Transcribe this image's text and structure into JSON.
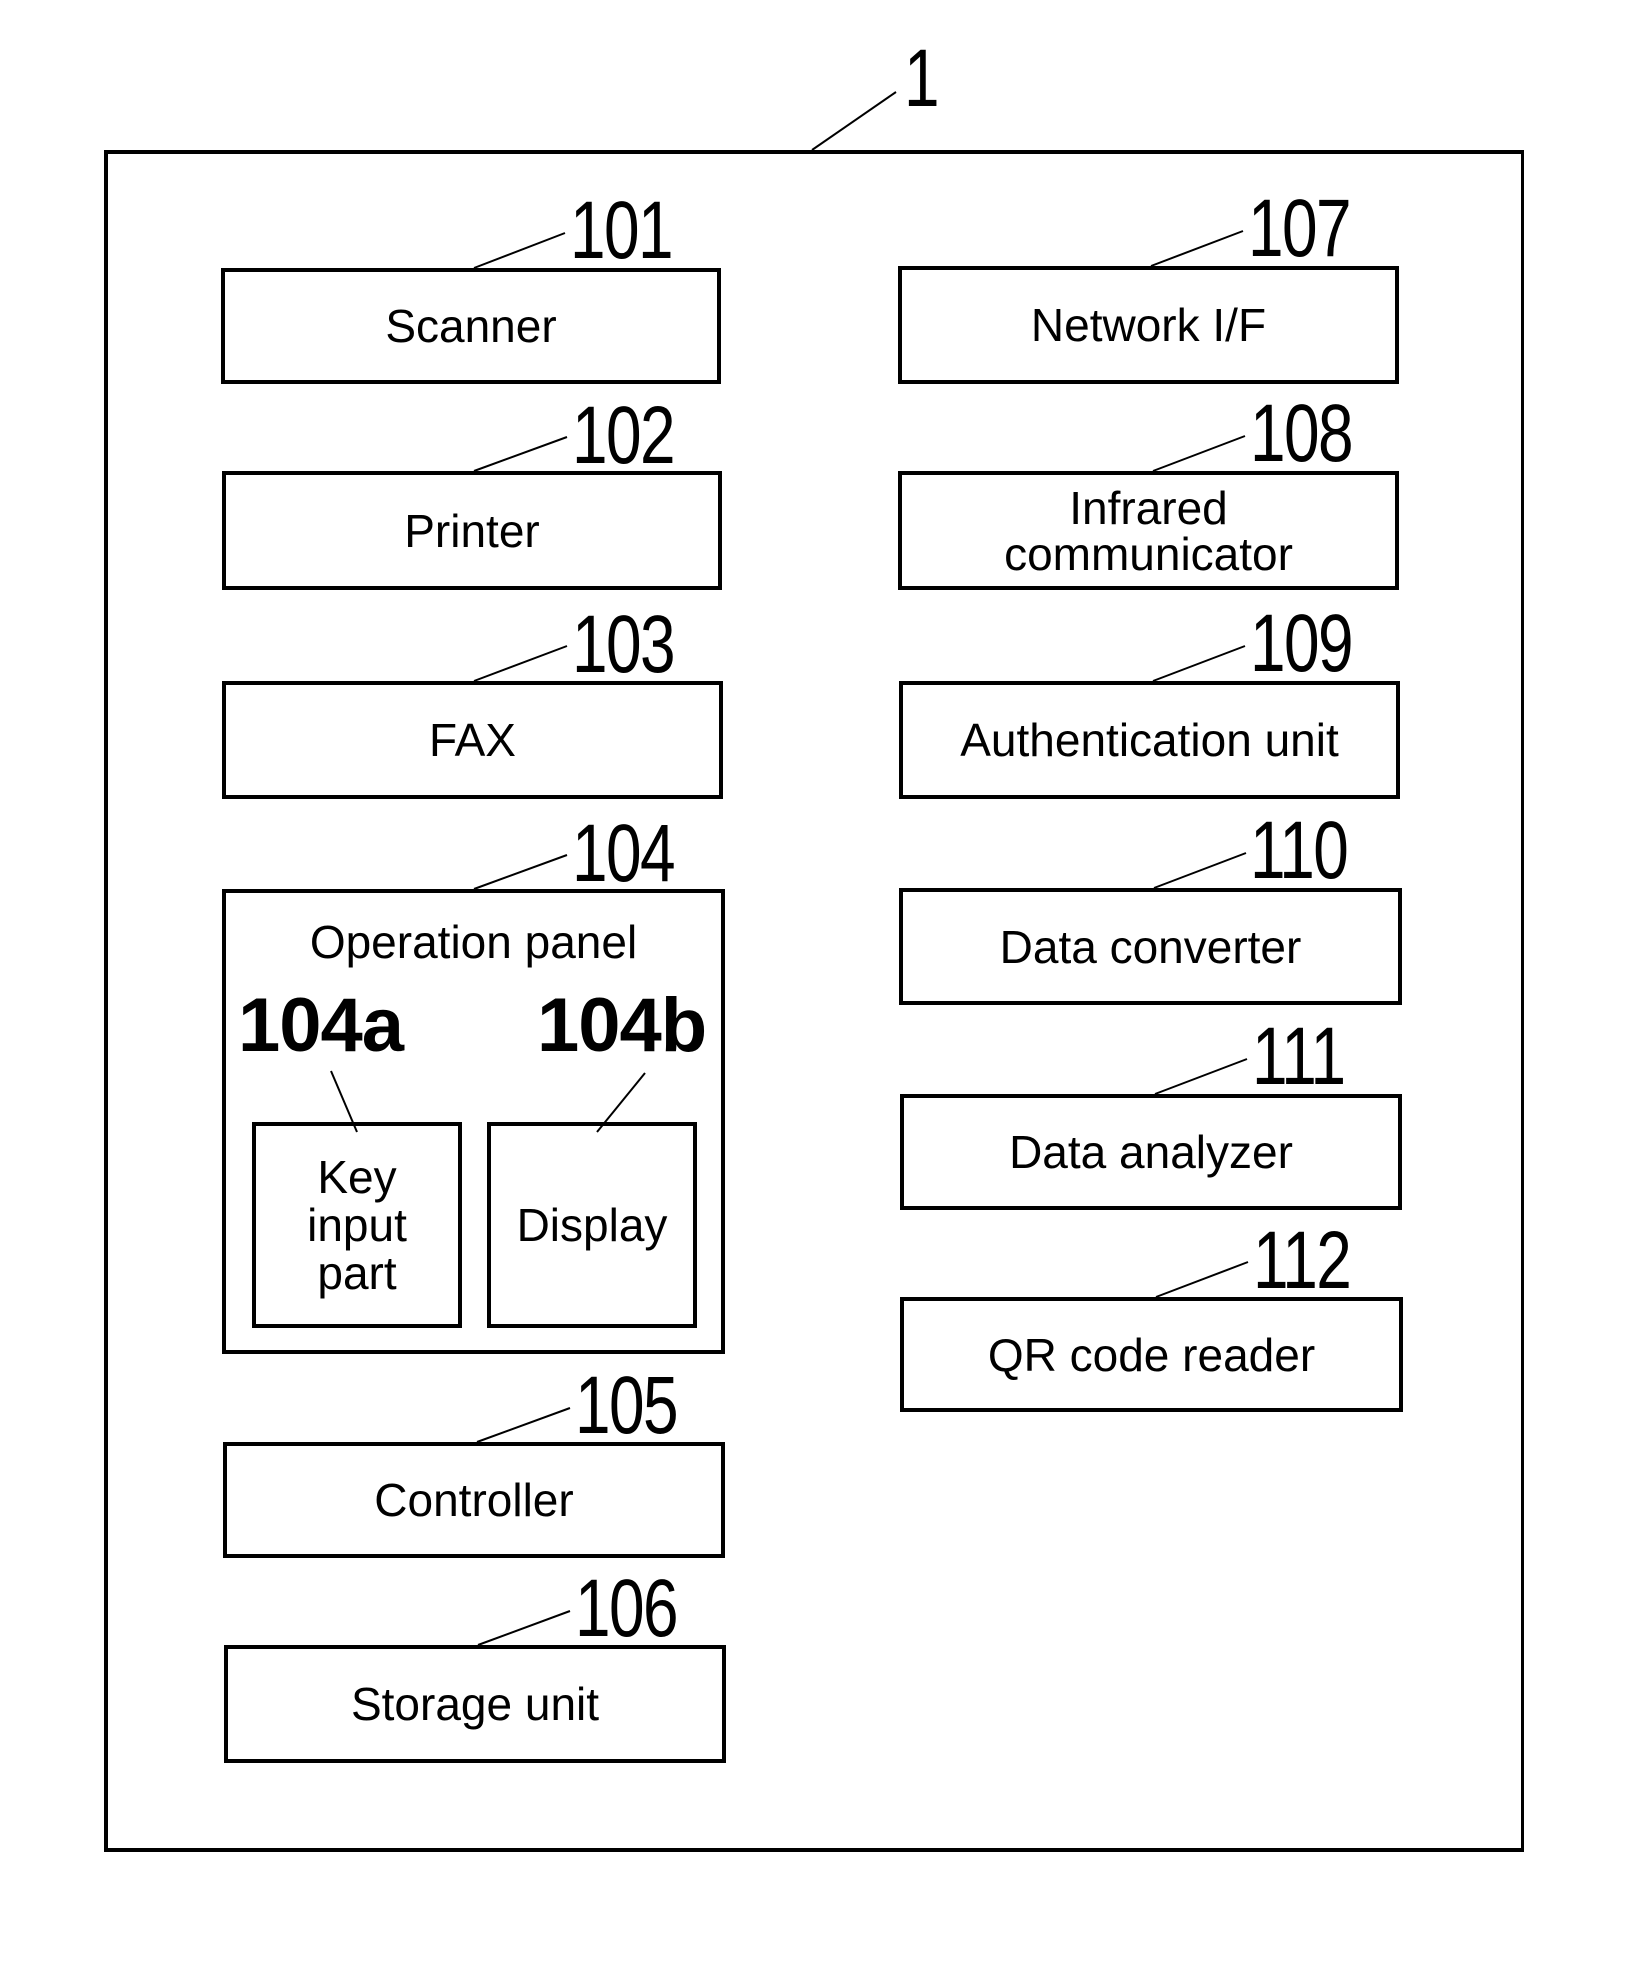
{
  "figure": {
    "ref": "1",
    "left_column": [
      {
        "ref": "101",
        "label": "Scanner"
      },
      {
        "ref": "102",
        "label": "Printer"
      },
      {
        "ref": "103",
        "label": "FAX"
      },
      {
        "ref": "104",
        "label": "Operation panel",
        "children": [
          {
            "ref": "104a",
            "label_lines": [
              "Key",
              "input",
              "part"
            ]
          },
          {
            "ref": "104b",
            "label_lines": [
              "Display"
            ]
          }
        ]
      },
      {
        "ref": "105",
        "label": "Controller"
      },
      {
        "ref": "106",
        "label": "Storage unit"
      }
    ],
    "right_column": [
      {
        "ref": "107",
        "label": "Network I/F"
      },
      {
        "ref": "108",
        "label_lines": [
          "Infrared",
          "communicator"
        ]
      },
      {
        "ref": "109",
        "label": "Authentication unit"
      },
      {
        "ref": "110",
        "label": "Data converter"
      },
      {
        "ref": "111",
        "label": "Data analyzer"
      },
      {
        "ref": "112",
        "label": "QR code reader"
      }
    ]
  }
}
